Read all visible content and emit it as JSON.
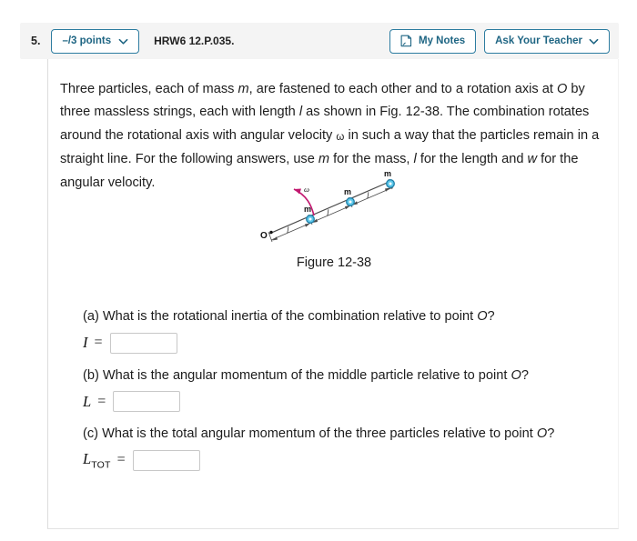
{
  "header": {
    "question_number": "5.",
    "points_label": "–/3 points",
    "points_chevron_icon": "chevron-down-icon",
    "question_code": "HRW6 12.P.035.",
    "my_notes_label": "My Notes",
    "my_notes_icon": "note-page-icon",
    "ask_teacher_label": "Ask Your Teacher",
    "ask_teacher_chevron_icon": "chevron-down-icon",
    "accent_color": "#2d7ca0",
    "bar_background": "#f4f4f4"
  },
  "stem": {
    "line1_a": "Three particles, each of mass ",
    "var_m1": "m",
    "line1_b": ", are fastened to each other and to a rotation axis at ",
    "var_O1": "O",
    "line1_c": " by three massless strings, each with length ",
    "var_l1": "l",
    "line1_d": " as shown in Fig. 12-38. The combination rotates around the rotational axis with angular velocity ",
    "var_omega": "ω",
    "line1_e": " in such a way that the particles remain in a straight line. For the following answers, use ",
    "var_m2": "m",
    "line1_f": " for the mass, ",
    "var_l2": "l",
    "line1_g": " for the length and ",
    "var_w": "w",
    "line1_h": " for the angular velocity."
  },
  "figure": {
    "caption": "Figure 12-38",
    "origin_label": "O",
    "mass_labels": [
      "m",
      "m",
      "m"
    ],
    "length_labels": [
      "l",
      "l",
      "l"
    ],
    "omega_label": "ω",
    "particle_fill": "#5ec8ea",
    "particle_stroke": "#1f7fa8",
    "omega_arrow_color": "#c2186f",
    "line_color": "#444444"
  },
  "parts": [
    {
      "prompt_a": "(a) What is the rotational inertia of the combination relative to point ",
      "prompt_var": "O",
      "prompt_b": "?",
      "answer_label": "I",
      "answer_sub": "",
      "equals": "=",
      "value": "",
      "placeholder": ""
    },
    {
      "prompt_a": "(b) What is the angular momentum of the middle particle relative to point ",
      "prompt_var": "O",
      "prompt_b": "?",
      "answer_label": "L",
      "answer_sub": "",
      "equals": "=",
      "value": "",
      "placeholder": ""
    },
    {
      "prompt_a": "(c) What is the total angular momentum of the three particles relative to point ",
      "prompt_var": "O",
      "prompt_b": "?",
      "answer_label": "L",
      "answer_sub": "TOT",
      "equals": "=",
      "value": "",
      "placeholder": ""
    }
  ]
}
